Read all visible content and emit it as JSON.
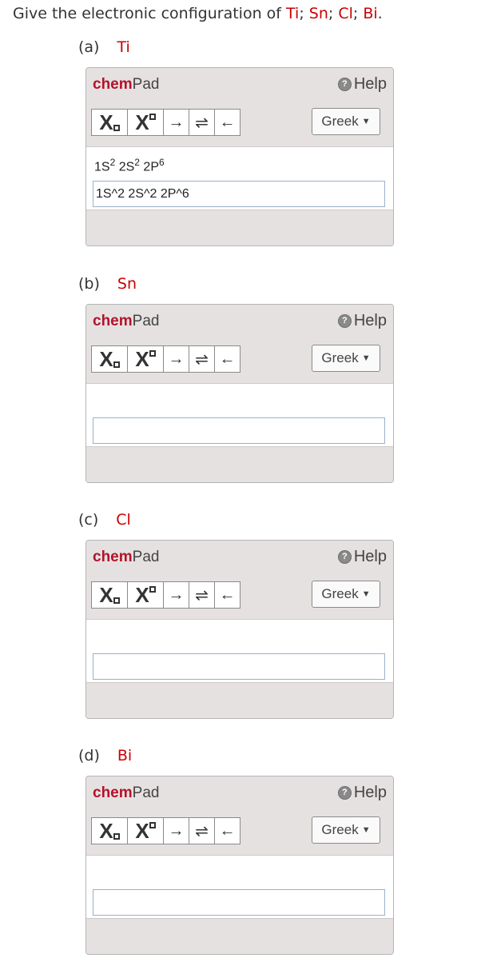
{
  "question": {
    "prefix": "Give the electronic configuration of ",
    "items": [
      "Ti",
      "Sn",
      "Cl",
      "Bi"
    ],
    "separator": "; ",
    "suffix": "."
  },
  "parts": [
    {
      "label": "(a)",
      "element": "Ti",
      "brand_chem": "chem",
      "brand_pad": "Pad",
      "help": "Help",
      "greek": "Greek",
      "display": [
        {
          "base": "1S",
          "exp": "2"
        },
        {
          "base": " 2S",
          "exp": "2"
        },
        {
          "base": " 2P",
          "exp": "6"
        }
      ],
      "input_value": "1S^2 2S^2 2P^6"
    },
    {
      "label": "(b)",
      "element": "Sn",
      "brand_chem": "chem",
      "brand_pad": "Pad",
      "help": "Help",
      "greek": "Greek",
      "display": [],
      "input_value": ""
    },
    {
      "label": "(c)",
      "element": "Cl",
      "brand_chem": "chem",
      "brand_pad": "Pad",
      "help": "Help",
      "greek": "Greek",
      "display": [],
      "input_value": ""
    },
    {
      "label": "(d)",
      "element": "Bi",
      "brand_chem": "chem",
      "brand_pad": "Pad",
      "help": "Help",
      "greek": "Greek",
      "display": [],
      "input_value": ""
    }
  ],
  "toolbar": {
    "subscript_label": "X",
    "superscript_label": "X",
    "arrow_forward": "→",
    "arrow_equilibrium": "⇌",
    "arrow_back": "←"
  },
  "colors": {
    "accent_red": "#cc0000",
    "brand_red": "#b3132b",
    "panel_gray": "#e5e1e1"
  },
  "icons": [
    "help-icon",
    "caret-down-icon",
    "subscript-icon",
    "superscript-icon",
    "right-arrow-icon",
    "equilibrium-arrow-icon",
    "left-arrow-icon"
  ]
}
